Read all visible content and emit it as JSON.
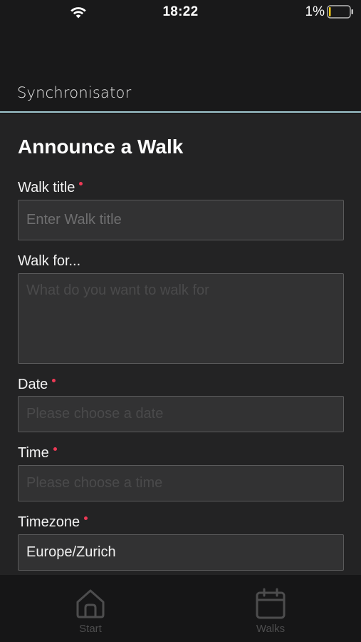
{
  "status_bar": {
    "time": "18:22",
    "battery_percent": "1%",
    "battery_level": 0.01,
    "battery_color": "#f2c812"
  },
  "app_bar": {
    "title": "Synchronisator",
    "accent_color": "#9fc7cf"
  },
  "form": {
    "heading": "Announce a Walk",
    "required_color": "#ee3a56",
    "fields": {
      "walk_title": {
        "label": "Walk title",
        "required": true,
        "placeholder": "Enter Walk title",
        "value": ""
      },
      "walk_for": {
        "label": "Walk for...",
        "required": false,
        "placeholder": "What do you want to walk for",
        "value": ""
      },
      "date": {
        "label": "Date",
        "required": true,
        "placeholder": "Please choose a date",
        "value": ""
      },
      "time": {
        "label": "Time",
        "required": true,
        "placeholder": "Please choose a time",
        "value": ""
      },
      "timezone": {
        "label": "Timezone",
        "required": true,
        "placeholder": "",
        "value": "Europe/Zurich"
      }
    }
  },
  "tab_bar": {
    "tabs": [
      {
        "label": "Start",
        "icon": "home-icon"
      },
      {
        "label": "Walks",
        "icon": "calendar-icon"
      }
    ]
  }
}
